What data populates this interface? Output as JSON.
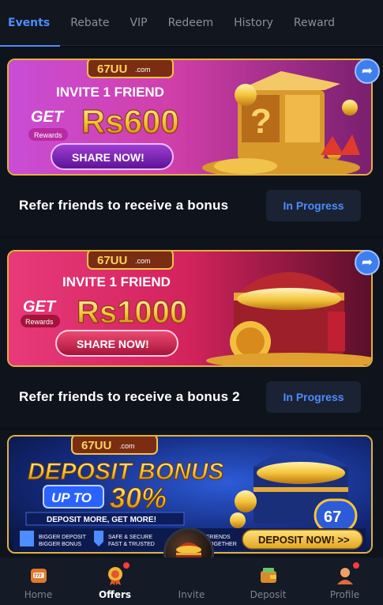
{
  "tabs": [
    {
      "label": "Events",
      "active": true
    },
    {
      "label": "Rebate",
      "active": false
    },
    {
      "label": "VIP",
      "active": false
    },
    {
      "label": "Redeem",
      "active": false
    },
    {
      "label": "History",
      "active": false
    },
    {
      "label": "Reward",
      "active": false
    }
  ],
  "cards": [
    {
      "banner": {
        "logo": "67UU",
        "logo_sub": ".com",
        "headline": "INVITE 1 FRIEND",
        "get": "GET",
        "rewards": "Rewards",
        "amount": "Rs600",
        "cta": "SHARE NOW!"
      },
      "title": "Refer friends to receive a bonus",
      "status": "In Progress"
    },
    {
      "banner": {
        "logo": "67UU",
        "logo_sub": ".com",
        "headline": "INVITE 1 FRIEND",
        "get": "GET",
        "rewards": "Rewards",
        "amount": "Rs1000",
        "cta": "SHARE NOW!"
      },
      "title": "Refer friends to receive a bonus 2",
      "status": "In Progress"
    },
    {
      "banner": {
        "logo": "67UU",
        "logo_sub": ".com",
        "headline": "DEPOSIT BONUS",
        "up_to": "UP TO",
        "percent": "30%",
        "tagline": "DEPOSIT MORE, GET MORE!",
        "badge1_a": "BIGGER DEPOSIT",
        "badge1_b": "BIGGER BONUS",
        "badge2_a": "SAFE & SECURE",
        "badge2_b": "FAST & TRUSTED",
        "badge3_a": "FRIENDS",
        "badge3_b": "TOGETHER",
        "cta": "DEPOSIT NOW! >>",
        "chest_label": "67"
      }
    }
  ],
  "nav": [
    {
      "label": "Home",
      "icon": "slot-machine-icon",
      "active": false
    },
    {
      "label": "Offers",
      "icon": "gift-medal-icon",
      "active": true
    },
    {
      "label": "Invite",
      "icon": "treasure-chest-icon",
      "active": false
    },
    {
      "label": "Deposit",
      "icon": "wallet-icon",
      "active": false
    },
    {
      "label": "Profile",
      "icon": "user-icon",
      "active": false
    }
  ],
  "colors": {
    "accent": "#4c8dff",
    "bg": "#0c0f17",
    "gold": "#e2b23a",
    "badge_red": "#ff3b3b"
  }
}
